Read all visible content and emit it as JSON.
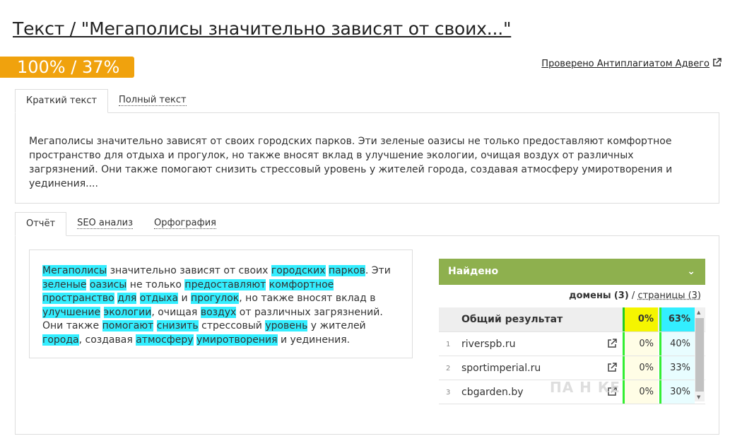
{
  "title": "Текст / \"Мегаполисы значительно зависят от своих...\"",
  "score": "100% / 37%",
  "checked_link": "Проверено Антиплагиатом Адвего",
  "text_tabs": [
    {
      "label": "Краткий текст",
      "active": true
    },
    {
      "label": "Полный текст",
      "active": false
    }
  ],
  "short_text": "Мегаполисы значительно зависят от своих городских парков. Эти зеленые оазисы не только предоставляют комфортное пространство для отдыха и прогулок, но также вносят вклад в улучшение экологии, очищая воздух от различных загрязнений. Они также помогают снизить стрессовый уровень у жителей города, создавая атмосферу умиротворения и уединения....",
  "report_tabs": [
    {
      "label": "Отчёт",
      "active": true
    },
    {
      "label": "SEO анализ",
      "active": false
    },
    {
      "label": "Орфография",
      "active": false
    }
  ],
  "report_text_segments": [
    {
      "t": "Мегаполисы",
      "h": true
    },
    {
      "t": " значительно зависят от своих ",
      "h": false
    },
    {
      "t": "городских",
      "h": true
    },
    {
      "t": " ",
      "h": false
    },
    {
      "t": "парков",
      "h": true
    },
    {
      "t": ". Эти ",
      "h": false
    },
    {
      "t": "зеленые",
      "h": true
    },
    {
      "t": " ",
      "h": false
    },
    {
      "t": "оазисы",
      "h": true
    },
    {
      "t": " не только ",
      "h": false
    },
    {
      "t": "предоставляют",
      "h": true
    },
    {
      "t": " ",
      "h": false
    },
    {
      "t": "комфортное",
      "h": true
    },
    {
      "t": " ",
      "h": false
    },
    {
      "t": "пространство",
      "h": true
    },
    {
      "t": " ",
      "h": false
    },
    {
      "t": "для",
      "h": true
    },
    {
      "t": " ",
      "h": false
    },
    {
      "t": "отдыха",
      "h": true
    },
    {
      "t": " и ",
      "h": false
    },
    {
      "t": "прогулок",
      "h": true
    },
    {
      "t": ", но также вносят вклад в ",
      "h": false
    },
    {
      "t": "улучшение",
      "h": true
    },
    {
      "t": " ",
      "h": false
    },
    {
      "t": "экологии",
      "h": true
    },
    {
      "t": ", очищая ",
      "h": false
    },
    {
      "t": "воздух",
      "h": true
    },
    {
      "t": " от различных загрязнений. Они также ",
      "h": false
    },
    {
      "t": "помогают",
      "h": true
    },
    {
      "t": " ",
      "h": false
    },
    {
      "t": "снизить",
      "h": true
    },
    {
      "t": " стрессовый ",
      "h": false
    },
    {
      "t": "уровень",
      "h": true
    },
    {
      "t": " у жителей ",
      "h": false
    },
    {
      "t": "города",
      "h": true
    },
    {
      "t": ", создавая ",
      "h": false
    },
    {
      "t": "атмосферу",
      "h": true
    },
    {
      "t": " ",
      "h": false
    },
    {
      "t": "умиротворения",
      "h": true
    },
    {
      "t": " и уединения.",
      "h": false
    }
  ],
  "found": {
    "header": "Найдено",
    "domains_label": "домены",
    "domains_count": "(3)",
    "separator": "/",
    "pages_label": "страницы (3)",
    "total_label": "Общий результат",
    "total_a": "0%",
    "total_b": "63%",
    "rows": [
      {
        "num": "1",
        "domain": "riverspb.ru",
        "a": "0%",
        "b": "40%"
      },
      {
        "num": "2",
        "domain": "sportimperial.ru",
        "a": "0%",
        "b": "33%"
      },
      {
        "num": "3",
        "domain": "cbgarden.by",
        "a": "0%",
        "b": "30%"
      }
    ]
  },
  "colors": {
    "accent_orange": "#f0a20d",
    "found_green": "#8eb04e",
    "highlight_cyan": "#33eeff",
    "yellow": "#f5f500"
  },
  "watermark": "ПА  Н  КЕ"
}
